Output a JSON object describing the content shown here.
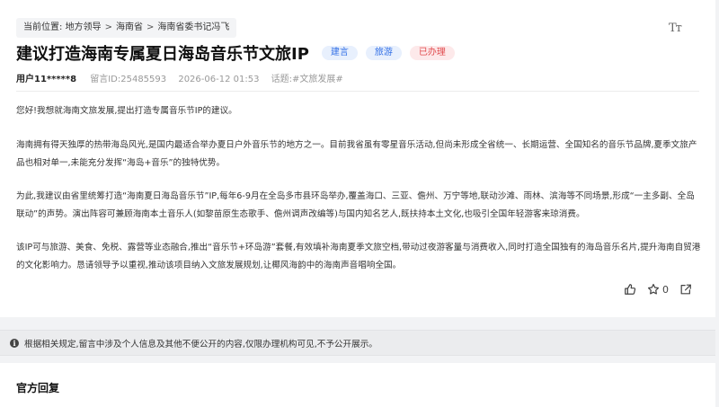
{
  "breadcrumb": {
    "prefix": "当前位置:",
    "items": [
      "地方领导",
      "海南省",
      "海南省委书记冯飞"
    ],
    "separator": ">"
  },
  "font_size_button": "Tт",
  "post": {
    "title": "建议打造海南专属夏日海岛音乐节文旅IP",
    "tags": [
      {
        "label": "建言",
        "color": "#3370e6"
      },
      {
        "label": "旅游",
        "color": "#3370e6"
      },
      {
        "label": "已办理",
        "color": "#e14b4e"
      }
    ],
    "meta": {
      "user": "用户11*****8",
      "id_text": "留言ID:25485593",
      "date": "2026-06-12 01:53",
      "topic_text": "话题:#文旅发展#"
    },
    "paragraphs": [
      "您好!我想就海南文旅发展,提出打造专属音乐节IP的建议。",
      "海南拥有得天独厚的热带海岛风光,是国内最适合举办夏日户外音乐节的地方之一。目前我省虽有零星音乐活动,但尚未形成全省统一、长期运营、全国知名的音乐节品牌,夏季文旅产品也相对单一,未能充分发挥“海岛+音乐”的独特优势。",
      "为此,我建议由省里统筹打造“海南夏日海岛音乐节”IP,每年6-9月在全岛多市县环岛举办,覆盖海口、三亚、儋州、万宁等地,联动沙滩、雨林、滨海等不同场景,形成“一主多副、全岛联动”的声势。演出阵容可兼顾海南本土音乐人(如黎苗原生态歌手、儋州调声改编等)与国内知名艺人,既扶持本土文化,也吸引全国年轻游客来琼消费。",
      "该IP可与旅游、美食、免税、露营等业态融合,推出“音乐节+环岛游”套餐,有效填补海南夏季文旅空档,带动过夜游客量与消费收入,同时打造全国独有的海岛音乐名片,提升海南自贸港的文化影响力。恳请领导予以重视,推动该项目纳入文旅发展规划,让椰风海韵中的海南声音唱响全国。"
    ],
    "actions": {
      "like_icon": "thumbs-up-icon",
      "favorite_icon": "star-icon",
      "favorite_count": "0",
      "share_icon": "share-icon"
    }
  },
  "notice": {
    "icon": "info-icon",
    "text": "根据相关规定,留言中涉及个人信息及其他不便公开的内容,仅限办理机构可见,不予公开展示。"
  },
  "reply": {
    "title": "官方回复"
  }
}
